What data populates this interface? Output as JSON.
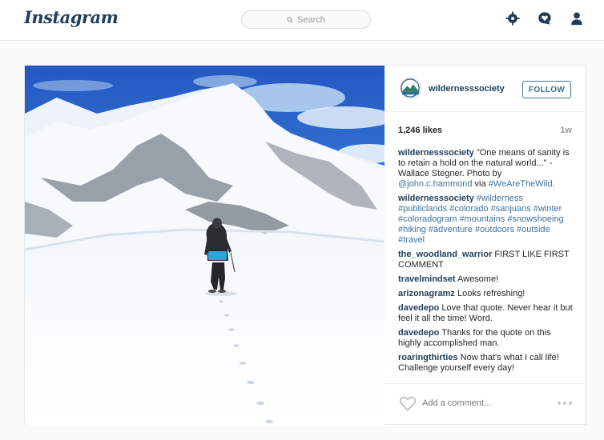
{
  "header": {
    "logo": "Instagram",
    "search_placeholder": "Search",
    "icons": [
      "explore-icon",
      "activity-icon",
      "profile-icon"
    ]
  },
  "post": {
    "username": "wildernesssociety",
    "follow_label": "FOLLOW",
    "likes": "1,246 likes",
    "time_ago": "1w",
    "caption": {
      "user": "wildernesssociety",
      "text1": "\"One means of sanity is to retain a hold on the natural world...\" -Wallace Stegner. Photo by ",
      "photo_credit": "@john.c.hammond",
      "via": " via ",
      "hashtag": "#WeAreTheWild",
      "end": "."
    },
    "tags_comment": {
      "user": "wildernesssociety",
      "tags": [
        "#wilderness",
        "#publiclands",
        "#colorado",
        "#sanjuans",
        "#winter",
        "#coloradogram",
        "#mountains",
        "#snowshoeing",
        "#hiking",
        "#adventure",
        "#outdoors",
        "#outside",
        "#travel"
      ]
    },
    "comments": [
      {
        "user": "the_woodland_warrior",
        "text": "FIRST LIKE FIRST COMMENT"
      },
      {
        "user": "travelmindset",
        "text": "Awesome!"
      },
      {
        "user": "arizonagramz",
        "text": "Looks refreshing!"
      },
      {
        "user": "davedepo",
        "text": "Love that quote. Never hear it but feel it all the time! Word."
      },
      {
        "user": "davedepo",
        "text": "Thanks for the quote on this highly accomplished man."
      },
      {
        "user": "roaringthirties",
        "text": "Now that's what I call life! Challenge yourself every day!"
      }
    ],
    "add_comment_placeholder": "Add a comment...",
    "colors": {
      "username": "#1e3f5c",
      "link": "#3f729b",
      "follow_border": "#3f729b",
      "sky": "#2f6fcf",
      "snow": "#ffffff",
      "jacket": "#2c2c30",
      "backpack": "#2aa8d6"
    }
  }
}
